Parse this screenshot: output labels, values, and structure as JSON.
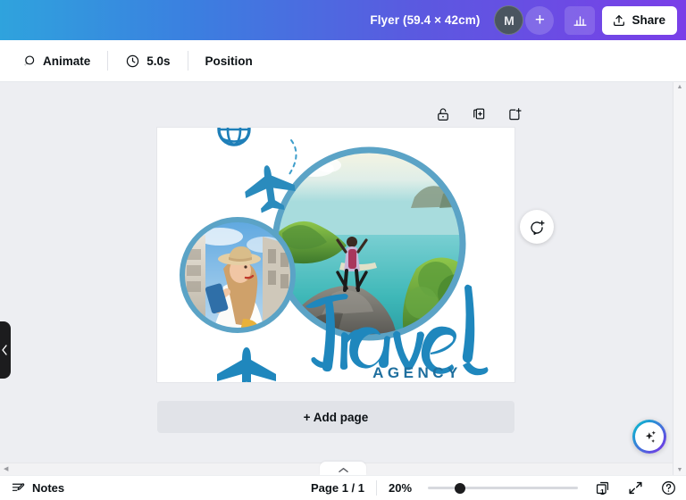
{
  "header": {
    "doc_title": "Flyer (59.4 × 42cm)",
    "avatar_initial": "M",
    "add_collaborator_label": "+",
    "insights_icon": "bar-chart-icon",
    "share_label": "Share",
    "gradient_from": "#2fa3dd",
    "gradient_to": "#7a3fe8"
  },
  "toolbar": {
    "animate_label": "Animate",
    "duration_label": "5.0s",
    "position_label": "Position"
  },
  "page_tools": {
    "lock_icon": "unlock-icon",
    "duplicate_icon": "duplicate-page-icon",
    "add_icon": "add-page-icon"
  },
  "canvas": {
    "comment_icon": "add-comment-icon",
    "add_page_label": "+ Add page",
    "magic_icon": "magic-sparkle-icon",
    "panel_collapse_icon": "chevron-left-icon"
  },
  "design": {
    "headline": "Travel",
    "subhead": "AGENCY",
    "accent_color": "#2a8bbd",
    "photo_1_alt": "woman-with-phone-city",
    "photo_2_alt": "hiker-on-cliff-ocean"
  },
  "bottombar": {
    "notes_label": "Notes",
    "page_indicator": "Page 1 / 1",
    "zoom_level": "20%",
    "grid_badge": "1",
    "grid_icon": "page-grid-icon",
    "fullscreen_icon": "fullscreen-icon",
    "help_icon": "help-circle-icon"
  }
}
